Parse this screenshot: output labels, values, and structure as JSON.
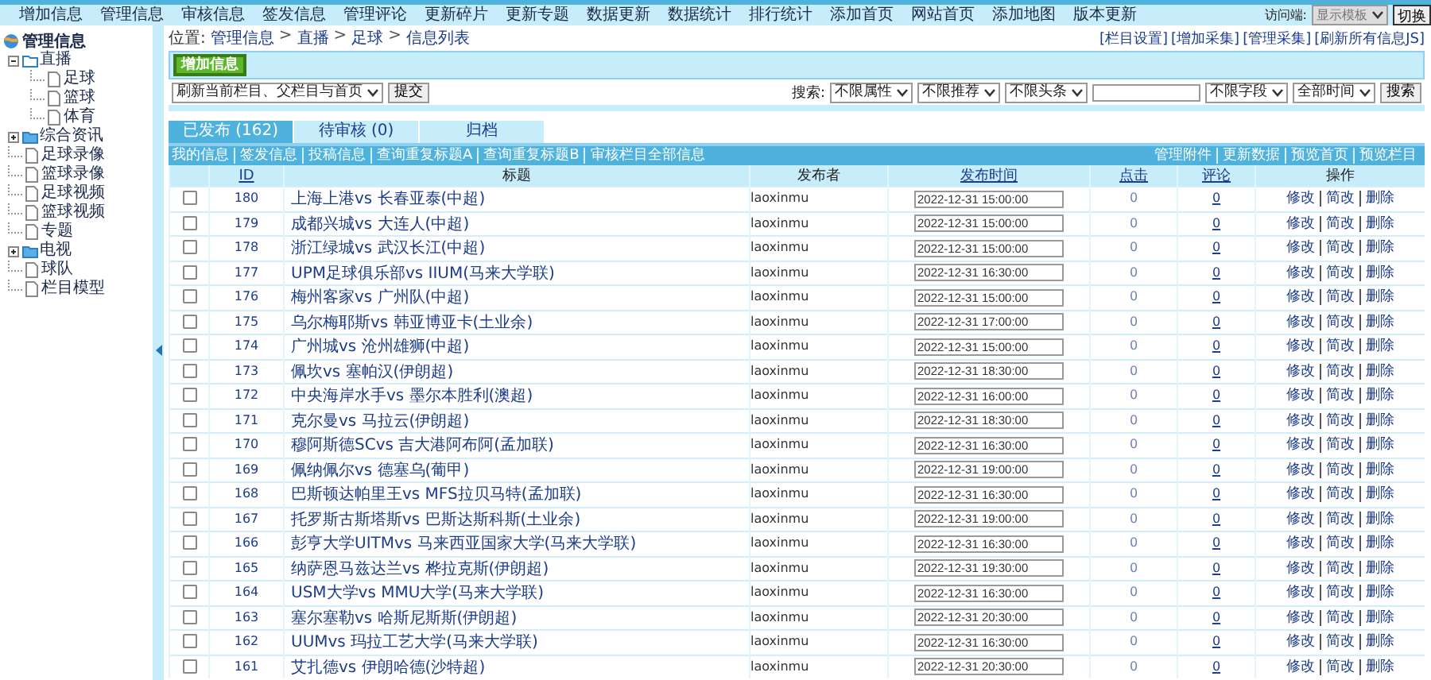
{
  "top_nav": {
    "items": [
      "增加信息",
      "管理信息",
      "审核信息",
      "签发信息",
      "管理评论",
      "更新碎片",
      "更新专题",
      "数据更新",
      "数据统计",
      "排行统计",
      "添加首页",
      "网站首页",
      "添加地图",
      "版本更新"
    ],
    "access_label": "访问端:",
    "access_select": "显示模板",
    "switch_button": "切换"
  },
  "sidebar": {
    "title": "管理信息",
    "items": [
      {
        "label": "直播",
        "kind": "folder",
        "expanded": true,
        "children": [
          {
            "label": "足球",
            "kind": "page"
          },
          {
            "label": "篮球",
            "kind": "page"
          },
          {
            "label": "体育",
            "kind": "page"
          }
        ]
      },
      {
        "label": "综合资讯",
        "kind": "folder",
        "expanded": false
      },
      {
        "label": "足球录像",
        "kind": "page"
      },
      {
        "label": "篮球录像",
        "kind": "page"
      },
      {
        "label": "足球视频",
        "kind": "page"
      },
      {
        "label": "篮球视频",
        "kind": "page"
      },
      {
        "label": "专题",
        "kind": "page"
      },
      {
        "label": "电视",
        "kind": "folder",
        "expanded": false
      },
      {
        "label": "球队",
        "kind": "page"
      },
      {
        "label": "栏目模型",
        "kind": "page"
      }
    ]
  },
  "breadcrumb": {
    "label": "位置:",
    "separator": ">",
    "items": [
      "管理信息",
      "直播",
      "足球",
      "信息列表"
    ]
  },
  "header_links": [
    "[栏目设置]",
    "[增加采集]",
    "[管理采集]",
    "[刷新所有信息JS]"
  ],
  "add_button": "增加信息",
  "refresh": {
    "select": "刷新当前栏目、父栏目与首页",
    "button": "提交"
  },
  "search": {
    "label": "搜索:",
    "selects_before": [
      "不限属性",
      "不限推荐",
      "不限头条"
    ],
    "selects_after": [
      "不限字段",
      "全部时间"
    ],
    "button": "搜索"
  },
  "tabs": [
    {
      "label": "已发布 (162)",
      "selected": true
    },
    {
      "label": "待审核 (0)",
      "selected": false
    },
    {
      "label": "归档",
      "selected": false
    }
  ],
  "list_links": [
    "我的信息",
    "签发信息",
    "投稿信息",
    "查询重复标题A",
    "查询重复标题B",
    "审核栏目全部信息"
  ],
  "tool_links": [
    "管理附件",
    "更新数据",
    "预览首页",
    "预览栏目"
  ],
  "table": {
    "columns": [
      {
        "label": "ID",
        "sortable": true
      },
      {
        "label": "标题",
        "sortable": false
      },
      {
        "label": "发布者",
        "sortable": false
      },
      {
        "label": "发布时间",
        "sortable": true
      },
      {
        "label": "点击",
        "sortable": true
      },
      {
        "label": "评论",
        "sortable": true
      },
      {
        "label": "操作",
        "sortable": false
      }
    ],
    "rows": [
      {
        "checked": false,
        "id": "180",
        "title": "上海上港vs 长春亚泰(中超)",
        "publisher": "laoxinmu",
        "time": "2022-12-31 15:00:00",
        "clicks": "0",
        "comments": "0",
        "actions": [
          "修改",
          "简改",
          "删除"
        ]
      },
      {
        "checked": false,
        "id": "179",
        "title": "成都兴城vs 大连人(中超)",
        "publisher": "laoxinmu",
        "time": "2022-12-31 15:00:00",
        "clicks": "0",
        "comments": "0",
        "actions": [
          "修改",
          "简改",
          "删除"
        ]
      },
      {
        "checked": false,
        "id": "178",
        "title": "浙江绿城vs 武汉长江(中超)",
        "publisher": "laoxinmu",
        "time": "2022-12-31 15:00:00",
        "clicks": "0",
        "comments": "0",
        "actions": [
          "修改",
          "简改",
          "删除"
        ]
      },
      {
        "checked": false,
        "id": "177",
        "title": "UPM足球俱乐部vs IIUM(马来大学联)",
        "publisher": "laoxinmu",
        "time": "2022-12-31 16:30:00",
        "clicks": "0",
        "comments": "0",
        "actions": [
          "修改",
          "简改",
          "删除"
        ]
      },
      {
        "checked": false,
        "id": "176",
        "title": "梅州客家vs 广州队(中超)",
        "publisher": "laoxinmu",
        "time": "2022-12-31 15:00:00",
        "clicks": "0",
        "comments": "0",
        "actions": [
          "修改",
          "简改",
          "删除"
        ]
      },
      {
        "checked": false,
        "id": "175",
        "title": "乌尔梅耶斯vs 韩亚博亚卡(土业余)",
        "publisher": "laoxinmu",
        "time": "2022-12-31 17:00:00",
        "clicks": "0",
        "comments": "0",
        "actions": [
          "修改",
          "简改",
          "删除"
        ]
      },
      {
        "checked": false,
        "id": "174",
        "title": "广州城vs 沧州雄狮(中超)",
        "publisher": "laoxinmu",
        "time": "2022-12-31 15:00:00",
        "clicks": "0",
        "comments": "0",
        "actions": [
          "修改",
          "简改",
          "删除"
        ]
      },
      {
        "checked": false,
        "id": "173",
        "title": "佩坎vs 塞帕汉(伊朗超)",
        "publisher": "laoxinmu",
        "time": "2022-12-31 18:30:00",
        "clicks": "0",
        "comments": "0",
        "actions": [
          "修改",
          "简改",
          "删除"
        ]
      },
      {
        "checked": false,
        "id": "172",
        "title": "中央海岸水手vs 墨尔本胜利(澳超)",
        "publisher": "laoxinmu",
        "time": "2022-12-31 16:00:00",
        "clicks": "0",
        "comments": "0",
        "actions": [
          "修改",
          "简改",
          "删除"
        ]
      },
      {
        "checked": false,
        "id": "171",
        "title": "克尔曼vs 马拉云(伊朗超)",
        "publisher": "laoxinmu",
        "time": "2022-12-31 18:30:00",
        "clicks": "0",
        "comments": "0",
        "actions": [
          "修改",
          "简改",
          "删除"
        ]
      },
      {
        "checked": false,
        "id": "170",
        "title": "穆阿斯德SCvs 吉大港阿布阿(孟加联)",
        "publisher": "laoxinmu",
        "time": "2022-12-31 16:30:00",
        "clicks": "0",
        "comments": "0",
        "actions": [
          "修改",
          "简改",
          "删除"
        ]
      },
      {
        "checked": false,
        "id": "169",
        "title": "佩纳佩尔vs 德塞乌(葡甲)",
        "publisher": "laoxinmu",
        "time": "2022-12-31 19:00:00",
        "clicks": "0",
        "comments": "0",
        "actions": [
          "修改",
          "简改",
          "删除"
        ]
      },
      {
        "checked": false,
        "id": "168",
        "title": "巴斯顿达帕里王vs MFS拉贝马特(孟加联)",
        "publisher": "laoxinmu",
        "time": "2022-12-31 16:30:00",
        "clicks": "0",
        "comments": "0",
        "actions": [
          "修改",
          "简改",
          "删除"
        ]
      },
      {
        "checked": false,
        "id": "167",
        "title": "托罗斯古斯塔斯vs 巴斯达斯科斯(土业余)",
        "publisher": "laoxinmu",
        "time": "2022-12-31 19:00:00",
        "clicks": "0",
        "comments": "0",
        "actions": [
          "修改",
          "简改",
          "删除"
        ]
      },
      {
        "checked": false,
        "id": "166",
        "title": "彭亨大学UITMvs 马来西亚国家大学(马来大学联)",
        "publisher": "laoxinmu",
        "time": "2022-12-31 16:30:00",
        "clicks": "0",
        "comments": "0",
        "actions": [
          "修改",
          "简改",
          "删除"
        ]
      },
      {
        "checked": false,
        "id": "165",
        "title": "纳萨恩马兹达兰vs 桦拉克斯(伊朗超)",
        "publisher": "laoxinmu",
        "time": "2022-12-31 19:30:00",
        "clicks": "0",
        "comments": "0",
        "actions": [
          "修改",
          "简改",
          "删除"
        ]
      },
      {
        "checked": false,
        "id": "164",
        "title": "USM大学vs MMU大学(马来大学联)",
        "publisher": "laoxinmu",
        "time": "2022-12-31 16:30:00",
        "clicks": "0",
        "comments": "0",
        "actions": [
          "修改",
          "简改",
          "删除"
        ]
      },
      {
        "checked": false,
        "id": "163",
        "title": "塞尔塞勒vs 哈斯尼斯斯(伊朗超)",
        "publisher": "laoxinmu",
        "time": "2022-12-31 20:30:00",
        "clicks": "0",
        "comments": "0",
        "actions": [
          "修改",
          "简改",
          "删除"
        ]
      },
      {
        "checked": false,
        "id": "162",
        "title": "UUMvs 玛拉工艺大学(马来大学联)",
        "publisher": "laoxinmu",
        "time": "2022-12-31 16:30:00",
        "clicks": "0",
        "comments": "0",
        "actions": [
          "修改",
          "简改",
          "删除"
        ]
      },
      {
        "checked": false,
        "id": "161",
        "title": "艾扎德vs 伊朗哈德(沙特超)",
        "publisher": "laoxinmu",
        "time": "2022-12-31 20:30:00",
        "clicks": "0",
        "comments": "0",
        "actions": [
          "修改",
          "简改",
          "删除"
        ]
      }
    ]
  }
}
